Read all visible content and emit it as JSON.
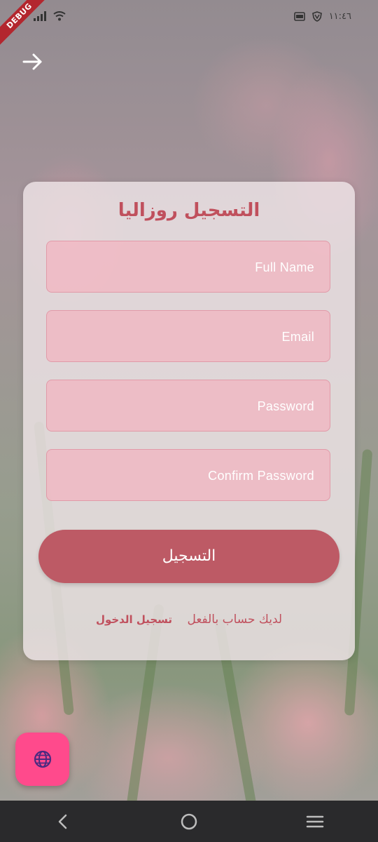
{
  "status_bar": {
    "debug_label": "DEBUG",
    "time": "١١:٤٦"
  },
  "card": {
    "title": "التسجيل روزاليا",
    "fields": [
      {
        "placeholder": "Full Name"
      },
      {
        "placeholder": "Email"
      },
      {
        "placeholder": "Password"
      },
      {
        "placeholder": "Confirm Password"
      }
    ],
    "register_label": "التسجيل",
    "have_account_text": "لديك حساب بالفعل",
    "login_link": "تسجيل الدخول"
  },
  "fab": {
    "icon": "globe-icon"
  },
  "nav_bar": {
    "icons": [
      "back-nav-icon",
      "home-nav-icon",
      "recents-nav-icon"
    ]
  },
  "colors": {
    "accent": "#c0505d",
    "button": "#bd5a65",
    "fab": "#ff4a8c",
    "field_fill": "#f1b4c0"
  }
}
